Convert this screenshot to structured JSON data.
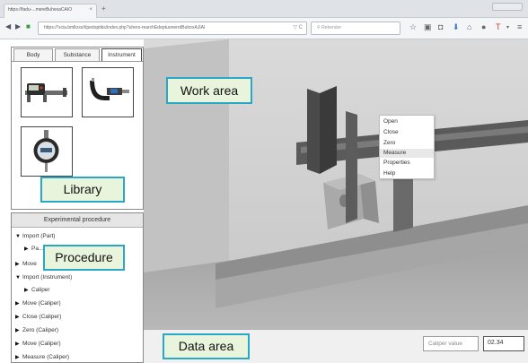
{
  "browser": {
    "tab_title": "https://fadu-...mereBuhexaCAIO",
    "tab_close": "×",
    "new_tab": "+",
    "url": "https://'scia.bmlloss/t/pedoptiks/index.php?uhers-rearchEdeptuonerrdBuhoxAJIAI",
    "search_placeholder": "Rebender",
    "url_actions": "▽ C"
  },
  "library": {
    "tabs": [
      "Body",
      "Substance",
      "Instrument"
    ],
    "active_tab": "Instrument",
    "items": [
      {
        "name": "Caliper"
      },
      {
        "name": "Micrometer"
      },
      {
        "name": "Dial gauge"
      }
    ]
  },
  "procedure": {
    "header": "Experimental procedure",
    "items": [
      {
        "label": "Import (Part)",
        "expanded": true,
        "indent": 0
      },
      {
        "label": "Pa...",
        "expanded": false,
        "indent": 1
      },
      {
        "label": "Move",
        "expanded": false,
        "indent": 0
      },
      {
        "label": "Import (Instrument)",
        "expanded": true,
        "indent": 0
      },
      {
        "label": "Caliper",
        "expanded": false,
        "indent": 1
      },
      {
        "label": "Move (Caliper)",
        "expanded": false,
        "indent": 0
      },
      {
        "label": "Close (Caliper)",
        "expanded": false,
        "indent": 0
      },
      {
        "label": "Zero (Caliper)",
        "expanded": false,
        "indent": 0
      },
      {
        "label": "Move (Caliper)",
        "expanded": false,
        "indent": 0
      },
      {
        "label": "Measure (Caliper)",
        "expanded": false,
        "indent": 0
      }
    ]
  },
  "context_menu": {
    "items": [
      "Open",
      "Close",
      "Zero",
      "Measure",
      "Properties",
      "Help"
    ],
    "highlighted": "Measure"
  },
  "data_area": {
    "label": "Caliper value",
    "value": "02.34"
  },
  "callouts": {
    "work_area": "Work area",
    "library": "Library",
    "procedure": "Procedure",
    "data_area": "Data area"
  },
  "colors": {
    "callout_border": "#2aa7c4",
    "callout_fill": "#e9f4dc",
    "scene_bg": "#cfcfcf"
  }
}
